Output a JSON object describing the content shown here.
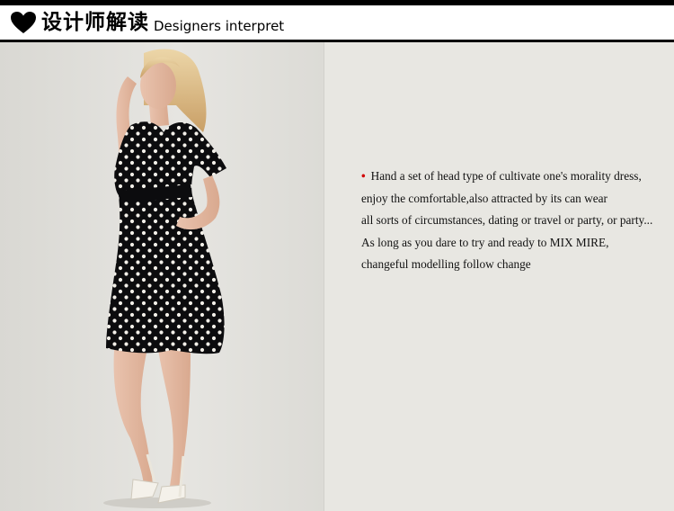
{
  "header": {
    "icon": "heart-icon",
    "title_cn": "设计师解读",
    "title_en": "Designers interpret"
  },
  "photo": {
    "subject": "model-photo"
  },
  "description": {
    "bullet_color": "#d10000",
    "lines": [
      "Hand a set of head type of cultivate one's morality dress,",
      "enjoy the comfortable,also attracted by its can wear",
      "all sorts of circumstances, dating or travel or party, or party...",
      "As long as you dare to try and ready to MIX MIRE,",
      "changeful modelling follow change"
    ]
  }
}
